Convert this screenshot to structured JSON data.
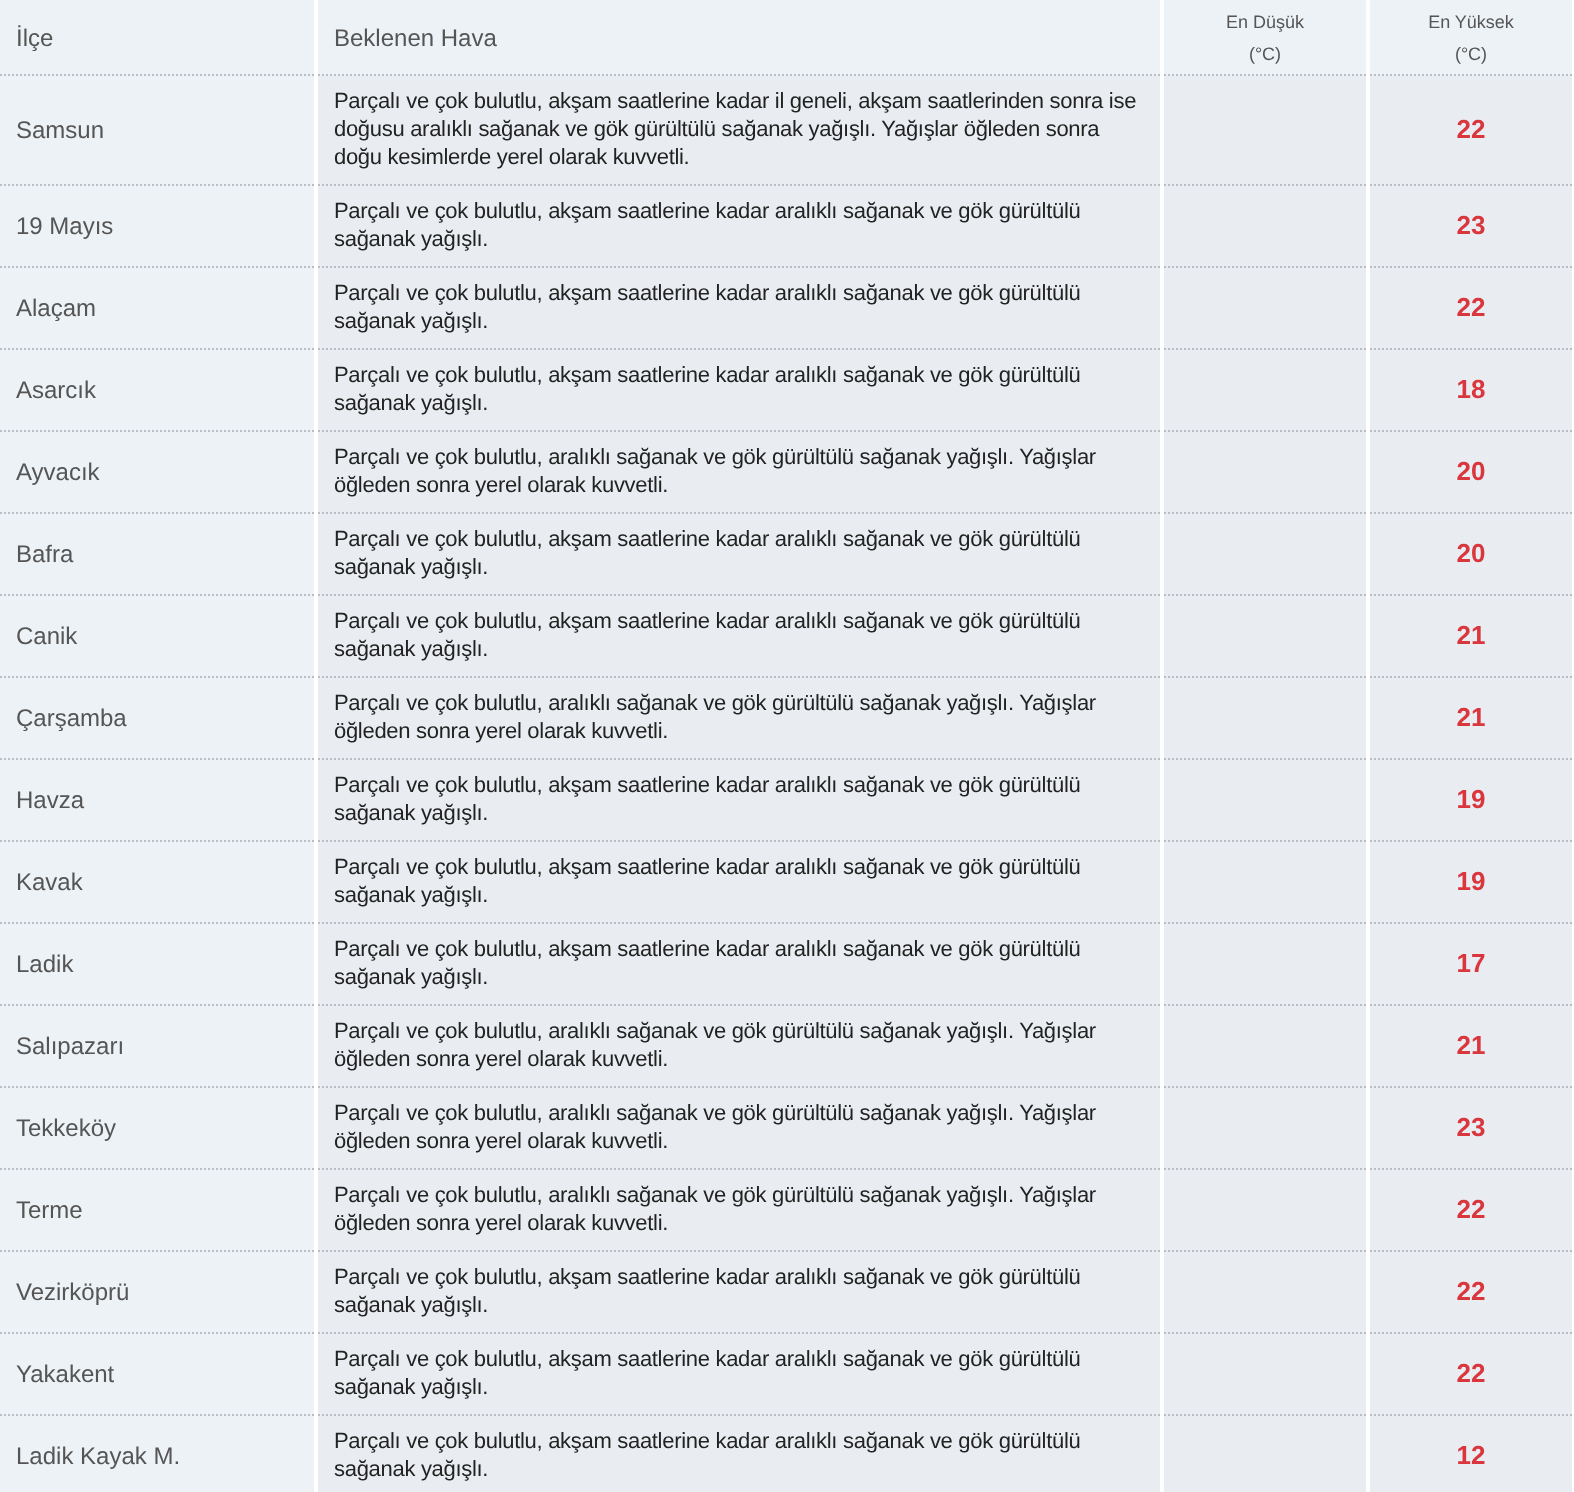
{
  "table": {
    "columns": [
      {
        "label": "İlçe"
      },
      {
        "label": "Beklenen Hava"
      },
      {
        "label": "En Düşük",
        "unit": "(°C)"
      },
      {
        "label": "En Yüksek",
        "unit": "(°C)"
      }
    ],
    "rows": [
      {
        "district": "Samsun",
        "forecast": "Parçalı ve çok bulutlu, akşam saatlerine kadar il geneli, akşam saatlerinden sonra ise doğusu aralıklı sağanak ve gök gürültülü sağanak yağışlı. Yağışlar öğleden sonra doğu kesimlerde yerel olarak kuvvetli.",
        "max": "22"
      },
      {
        "district": "19 Mayıs",
        "forecast": "Parçalı ve çok bulutlu, akşam saatlerine kadar aralıklı sağanak ve gök gürültülü sağanak yağışlı.",
        "max": "23"
      },
      {
        "district": "Alaçam",
        "forecast": "Parçalı ve çok bulutlu, akşam saatlerine kadar aralıklı sağanak ve gök gürültülü sağanak yağışlı.",
        "max": "22"
      },
      {
        "district": "Asarcık",
        "forecast": "Parçalı ve çok bulutlu, akşam saatlerine kadar aralıklı sağanak ve gök gürültülü sağanak yağışlı.",
        "max": "18"
      },
      {
        "district": "Ayvacık",
        "forecast": "Parçalı ve çok bulutlu, aralıklı sağanak ve gök gürültülü sağanak yağışlı. Yağışlar öğleden sonra yerel olarak kuvvetli.",
        "max": "20"
      },
      {
        "district": "Bafra",
        "forecast": "Parçalı ve çok bulutlu, akşam saatlerine kadar aralıklı sağanak ve gök gürültülü sağanak yağışlı.",
        "max": "20"
      },
      {
        "district": "Canik",
        "forecast": "Parçalı ve çok bulutlu, akşam saatlerine kadar aralıklı sağanak ve gök gürültülü sağanak yağışlı.",
        "max": "21"
      },
      {
        "district": "Çarşamba",
        "forecast": "Parçalı ve çok bulutlu, aralıklı sağanak ve gök gürültülü sağanak yağışlı. Yağışlar öğleden sonra yerel olarak kuvvetli.",
        "max": "21"
      },
      {
        "district": "Havza",
        "forecast": "Parçalı ve çok bulutlu, akşam saatlerine kadar aralıklı sağanak ve gök gürültülü sağanak yağışlı.",
        "max": "19"
      },
      {
        "district": "Kavak",
        "forecast": "Parçalı ve çok bulutlu, akşam saatlerine kadar aralıklı sağanak ve gök gürültülü sağanak yağışlı.",
        "max": "19"
      },
      {
        "district": "Ladik",
        "forecast": "Parçalı ve çok bulutlu, akşam saatlerine kadar aralıklı sağanak ve gök gürültülü sağanak yağışlı.",
        "max": "17"
      },
      {
        "district": "Salıpazarı",
        "forecast": "Parçalı ve çok bulutlu, aralıklı sağanak ve gök gürültülü sağanak yağışlı. Yağışlar öğleden sonra yerel olarak kuvvetli.",
        "max": "21"
      },
      {
        "district": "Tekkeköy",
        "forecast": "Parçalı ve çok bulutlu, aralıklı sağanak ve gök gürültülü sağanak yağışlı. Yağışlar öğleden sonra yerel olarak kuvvetli.",
        "max": "23"
      },
      {
        "district": "Terme",
        "forecast": "Parçalı ve çok bulutlu, aralıklı sağanak ve gök gürültülü sağanak yağışlı. Yağışlar öğleden sonra yerel olarak kuvvetli.",
        "max": "22"
      },
      {
        "district": "Vezirköprü",
        "forecast": "Parçalı ve çok bulutlu, akşam saatlerine kadar aralıklı sağanak ve gök gürültülü sağanak yağışlı.",
        "max": "22"
      },
      {
        "district": "Yakakent",
        "forecast": "Parçalı ve çok bulutlu, akşam saatlerine kadar aralıklı sağanak ve gök gürültülü sağanak yağışlı.",
        "max": "22"
      },
      {
        "district": "Ladik Kayak M.",
        "forecast": "Parçalı ve çok bulutlu, akşam saatlerine kadar aralıklı sağanak ve gök gürültülü sağanak yağışlı.",
        "max": "12"
      }
    ]
  }
}
